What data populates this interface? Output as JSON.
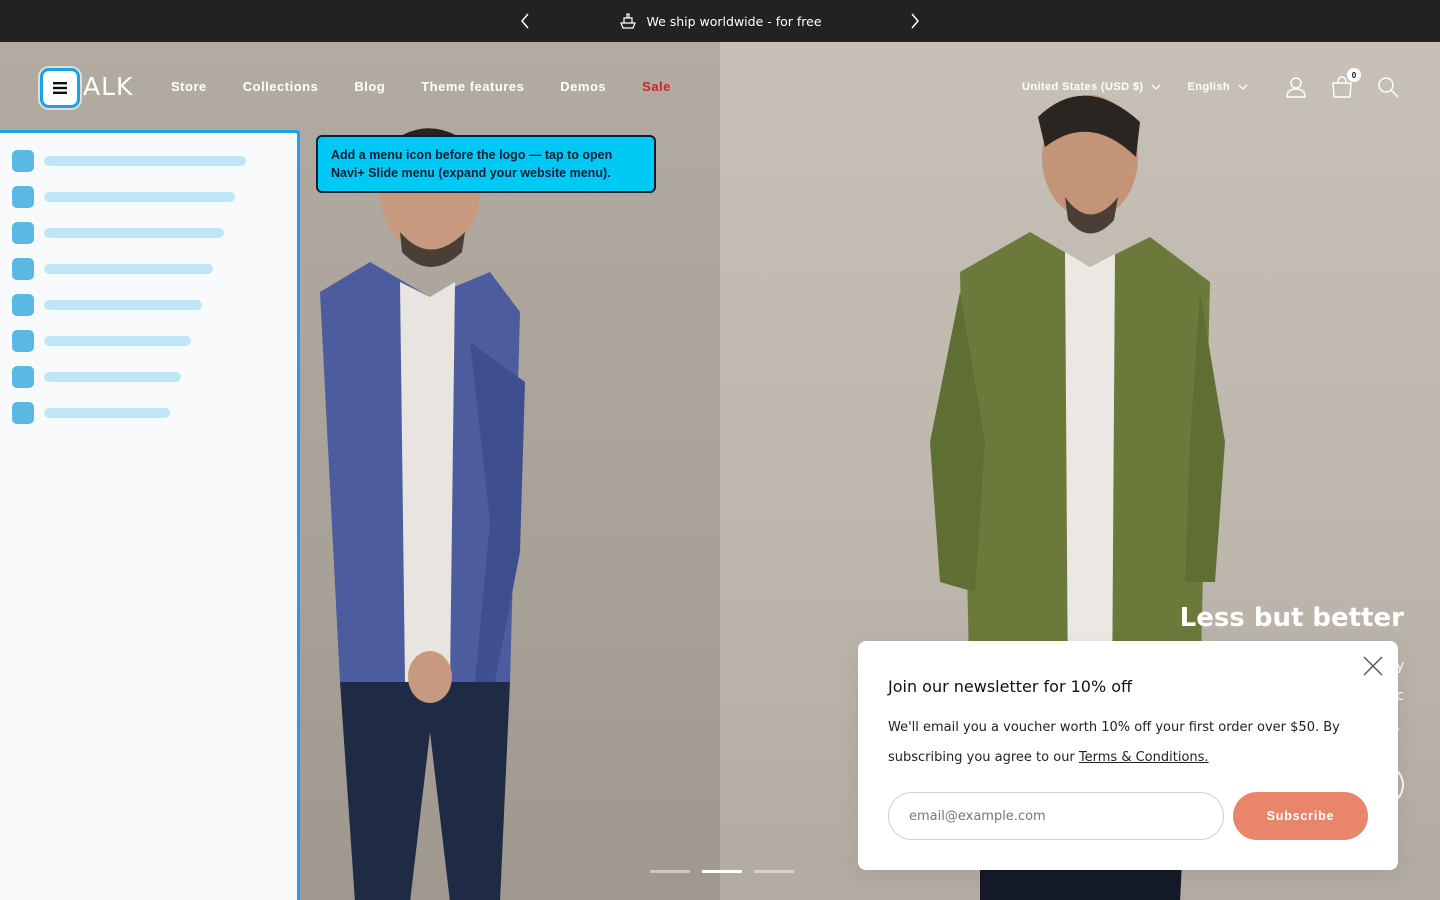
{
  "announcement": {
    "message": "We ship worldwide - for free",
    "icon": "ship-icon"
  },
  "header": {
    "logo_text": "ALK",
    "logo_icon": "hamburger-menu-icon",
    "nav": [
      {
        "label": "Store"
      },
      {
        "label": "Collections"
      },
      {
        "label": "Blog"
      },
      {
        "label": "Theme features"
      },
      {
        "label": "Demos"
      },
      {
        "label": "Sale"
      }
    ],
    "currency": "United States (USD $)",
    "language": "English",
    "cart_count": "0"
  },
  "tooltip": {
    "text": "Add a menu icon before the logo — tap to open Navi+ Slide menu (expand your website menu)."
  },
  "hero": {
    "title": "Less but better",
    "slide_count": 3,
    "active_slide": 2
  },
  "newsletter": {
    "title": "Join our newsletter for 10% off",
    "description": "We'll email you a voucher worth 10% off your first order over $50. By subscribing you agree to our",
    "terms_link": "Terms & Conditions.",
    "email_placeholder": "email@example.com",
    "subscribe_label": "Subscribe"
  },
  "colors": {
    "accent": "#19a3e6",
    "sale": "#d0232b",
    "subscribe": "#e9856a",
    "tooltip": "#00c8f5",
    "announcement_bg": "#222222"
  }
}
